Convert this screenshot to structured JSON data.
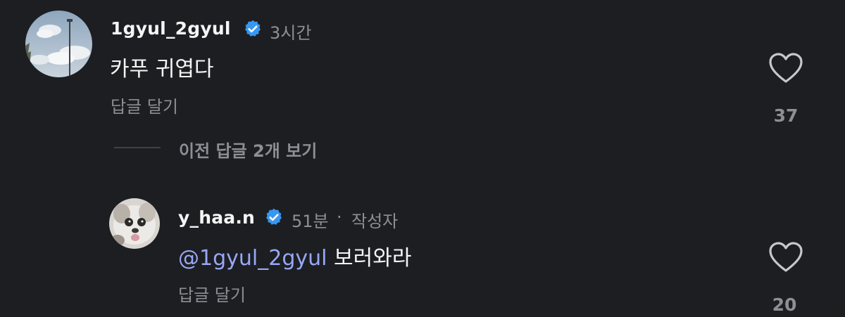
{
  "comment": {
    "username": "1gyul_2gyul",
    "verified_icon": "verified-badge-icon",
    "time": "3시간",
    "text": "카푸 귀엽다",
    "reply_label": "답글 달기",
    "like_icon": "heart-outline-icon",
    "likes": "37",
    "avatar_icon": "sky-streetlamp-avatar"
  },
  "view_previous_replies": "이전 답글 2개 보기",
  "reply": {
    "username": "y_haa.n",
    "verified_icon": "verified-badge-icon",
    "time": "51분",
    "separator": "·",
    "author_tag": "작성자",
    "mention": "@1gyul_2gyul",
    "text": "보러와라",
    "reply_label": "답글 달기",
    "like_icon": "heart-outline-icon",
    "likes": "20",
    "avatar_icon": "dog-avatar"
  },
  "colors": {
    "background": "#1c1e22",
    "verified": "#3897f0",
    "mention": "#98a8f5",
    "secondary_text": "#8e8e93"
  }
}
